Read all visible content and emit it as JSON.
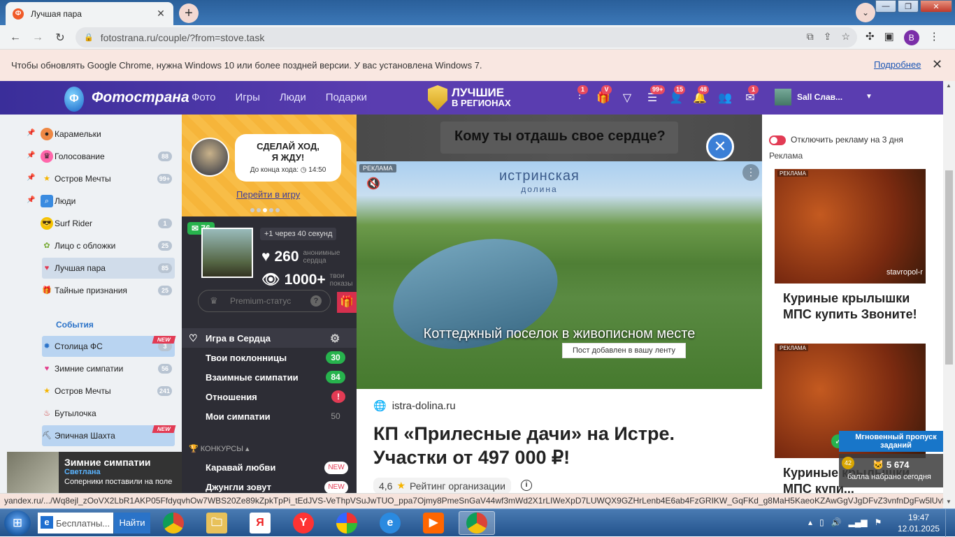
{
  "browser": {
    "tab_title": "Лучшая пара",
    "tab_favicon_letter": "Ф",
    "url": "fotostrana.ru/couple/?from=stove.task",
    "profile_letter": "B",
    "infobar_text": "Чтобы обновлять Google Chrome, нужна Windows 10 или более поздней версии. У вас установлена Windows 7.",
    "infobar_link": "Подробнее",
    "status_url": "yandex.ru/.../Wq8ejl_zOoVX2LbR1AKP05FfdyqvhOw7WBS20Ze89kZpkTpPi_tEdJVS-VeThpVSuJwTUO_ppa7Ojmy8PmeSnGaV44wf3mWd2X1rLIWeXpD7LUWQX9GZHrLenb4E6ab4FzGRIKW_GqFKd_g8MaH5KaeoKZAwGgVJgDFvZ3vnfnDgFw5lUvf7eyye5..."
  },
  "site": {
    "logo": "Фотострана",
    "logo_letter": "Ф",
    "nav": [
      "Фото",
      "Игры",
      "Люди",
      "Подарки"
    ],
    "regions_line1": "ЛУЧШИЕ",
    "regions_line2": "В РЕГИОНАХ",
    "header_badges": [
      "1",
      "V",
      "",
      "99+",
      "15",
      "48",
      "",
      "1"
    ],
    "user_name": "Sall Слав..."
  },
  "sidebar": {
    "items": [
      {
        "label": "Карамельки",
        "count": "",
        "icon": "candy-icon"
      },
      {
        "label": "Голосование",
        "count": "88",
        "icon": "vote-icon"
      },
      {
        "label": "Остров Мечты",
        "count": "99+",
        "icon": "star-icon"
      },
      {
        "label": "Люди",
        "count": "",
        "icon": "search-people-icon"
      },
      {
        "label": "Surf Rider",
        "count": "1",
        "icon": "sunglasses-icon"
      },
      {
        "label": "Лицо с обложки",
        "count": "25",
        "icon": "face-icon"
      },
      {
        "label": "Лучшая пара",
        "count": "85",
        "icon": "couple-icon"
      },
      {
        "label": "Тайные признания",
        "count": "25",
        "icon": "gift-icon"
      }
    ],
    "events_title": "События",
    "events": [
      {
        "label": "Столица ФС",
        "count": "3",
        "new": "NEW",
        "icon": "capital-icon"
      },
      {
        "label": "Зимние симпатии",
        "count": "56",
        "new": "",
        "icon": "heart-icon"
      },
      {
        "label": "Остров Мечты",
        "count": "241",
        "new": "",
        "icon": "star-icon"
      },
      {
        "label": "Бутылочка",
        "count": "",
        "new": "",
        "icon": "bottle-icon"
      },
      {
        "label": "Эпичная Шахта",
        "count": "",
        "new": "NEW",
        "icon": "mine-icon"
      }
    ],
    "notify": {
      "title": "Зимние симпатии",
      "name": "Светлана",
      "text": "Соперники поставили на поле"
    }
  },
  "game": {
    "bubble_line1": "СДЕЛАЙ ХОД,",
    "bubble_line2": "Я ЖДУ!",
    "bubble_timer": "До конца хода: ◷ 14:50",
    "go_link": "Перейти в игру",
    "messages": "76",
    "plus_one": "+1 через 40 секунд",
    "hearts_count": "260",
    "hearts_label": "анонимные сердца",
    "views_count": "1000+",
    "views_label": "твои показы",
    "premium": "Premium-статус",
    "menu": [
      {
        "label": "Игра в Сердца",
        "count": "",
        "style": "gear"
      },
      {
        "label": "Твои поклонницы",
        "count": "30",
        "style": "green"
      },
      {
        "label": "Взаимные симпатии",
        "count": "84",
        "style": "green"
      },
      {
        "label": "Отношения",
        "count": "!",
        "style": "red"
      },
      {
        "label": "Мои симпатии",
        "count": "50",
        "style": "plain"
      }
    ],
    "contests_title": "КОНКУРСЫ",
    "contests": [
      {
        "label": "Каравай любви",
        "tag": "NEW"
      },
      {
        "label": "Джунгли зовут",
        "tag": "NEW"
      }
    ]
  },
  "main": {
    "question": "Кому ты отдашь свое сердце?",
    "ad_label": "РЕКЛАМА",
    "ad_brand_line1": "истринская",
    "ad_brand_line2": "долина",
    "ad_caption": "Коттеджный поселок в живописном месте",
    "toast": "Пост добавлен в вашу ленту",
    "site": "istra-dolina.ru",
    "headline": "КП «Прилесные дачи» на Истре. Участки от 497 000 ₽!",
    "rating_value": "4,6",
    "rating_label": "Рейтинг организации"
  },
  "right": {
    "disable_ads": "Отключить рекламу на 3 дня",
    "ads_title": "Реклама",
    "cards": [
      {
        "label": "РЕКЛАМА",
        "source": "stavropol-r",
        "title": "Куриные крылышки МПС купить Звоните!"
      },
      {
        "label": "РЕКЛАМА",
        "source": "",
        "title": "Куриные крылышки МПС купи..."
      }
    ],
    "promo": "Мгновенный пропуск заданий",
    "score_num": "5 674",
    "score_text": "балла набрано сегодня",
    "level": "42"
  },
  "taskbar": {
    "search_placeholder": "Бесплатны...",
    "find_btn": "Найти",
    "time": "19:47",
    "date": "12.01.2025"
  }
}
